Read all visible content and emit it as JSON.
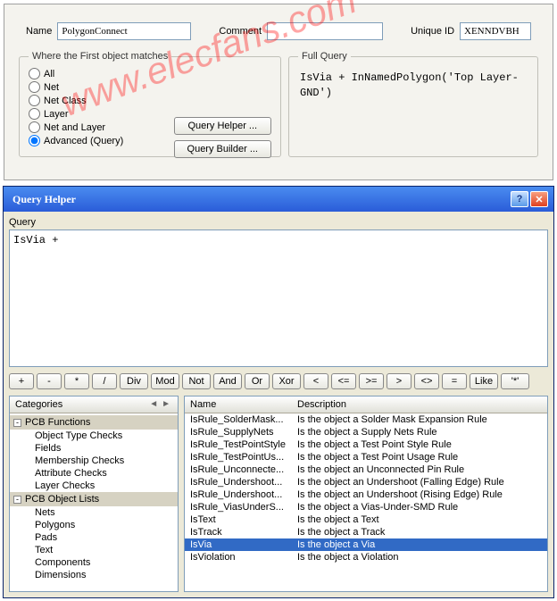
{
  "top": {
    "name_label": "Name",
    "name_value": "PolygonConnect",
    "comment_label": "Comment",
    "comment_value": "",
    "uid_label": "Unique ID",
    "uid_value": "XENNDVBH"
  },
  "match_group_title": "Where the First object matches",
  "full_query_title": "Full Query",
  "full_query_text": "IsVia + InNamedPolygon('Top Layer-GND')",
  "radios": {
    "all": "All",
    "net": "Net",
    "netclass": "Net Class",
    "layer": "Layer",
    "netlayer": "Net and Layer",
    "advanced": "Advanced (Query)"
  },
  "buttons": {
    "query_helper": "Query Helper ...",
    "query_builder": "Query Builder ..."
  },
  "watermark": "www.elecfans.com",
  "qh": {
    "title": "Query Helper",
    "query_label": "Query",
    "query_value": "IsVia +",
    "ops": [
      "+",
      "-",
      "*",
      "/",
      "Div",
      "Mod",
      "Not",
      "And",
      "Or",
      "Xor",
      "<",
      "<=",
      ">=",
      ">",
      "<>",
      "=",
      "Like",
      "'*'"
    ],
    "cat_header": "Categories",
    "tbl_name_header": "Name",
    "tbl_desc_header": "Description",
    "groups": [
      {
        "label": "PCB Functions",
        "items": [
          "Object Type Checks",
          "Fields",
          "Membership Checks",
          "Attribute Checks",
          "Layer Checks"
        ]
      },
      {
        "label": "PCB Object Lists",
        "items": [
          "Nets",
          "Polygons",
          "Pads",
          "Text",
          "Components",
          "Dimensions"
        ]
      }
    ],
    "rows": [
      {
        "name": "IsRule_SolderMask...",
        "desc": "Is the object a Solder Mask Expansion Rule"
      },
      {
        "name": "IsRule_SupplyNets",
        "desc": "Is the object a Supply Nets Rule"
      },
      {
        "name": "IsRule_TestPointStyle",
        "desc": "Is the object a Test Point Style Rule"
      },
      {
        "name": "IsRule_TestPointUs...",
        "desc": "Is the object a Test Point Usage Rule"
      },
      {
        "name": "IsRule_Unconnecte...",
        "desc": "Is the object an Unconnected Pin Rule"
      },
      {
        "name": "IsRule_Undershoot...",
        "desc": "Is the object an Undershoot (Falling Edge) Rule"
      },
      {
        "name": "IsRule_Undershoot...",
        "desc": "Is the object an Undershoot (Rising Edge) Rule"
      },
      {
        "name": "IsRule_ViasUnderS...",
        "desc": "Is the object a Vias-Under-SMD Rule"
      },
      {
        "name": "IsText",
        "desc": "Is the object a Text"
      },
      {
        "name": "IsTrack",
        "desc": "Is the object a Track"
      },
      {
        "name": "IsVia",
        "desc": "Is the object a Via",
        "selected": true
      },
      {
        "name": "IsViolation",
        "desc": "Is the object a Violation"
      }
    ]
  }
}
